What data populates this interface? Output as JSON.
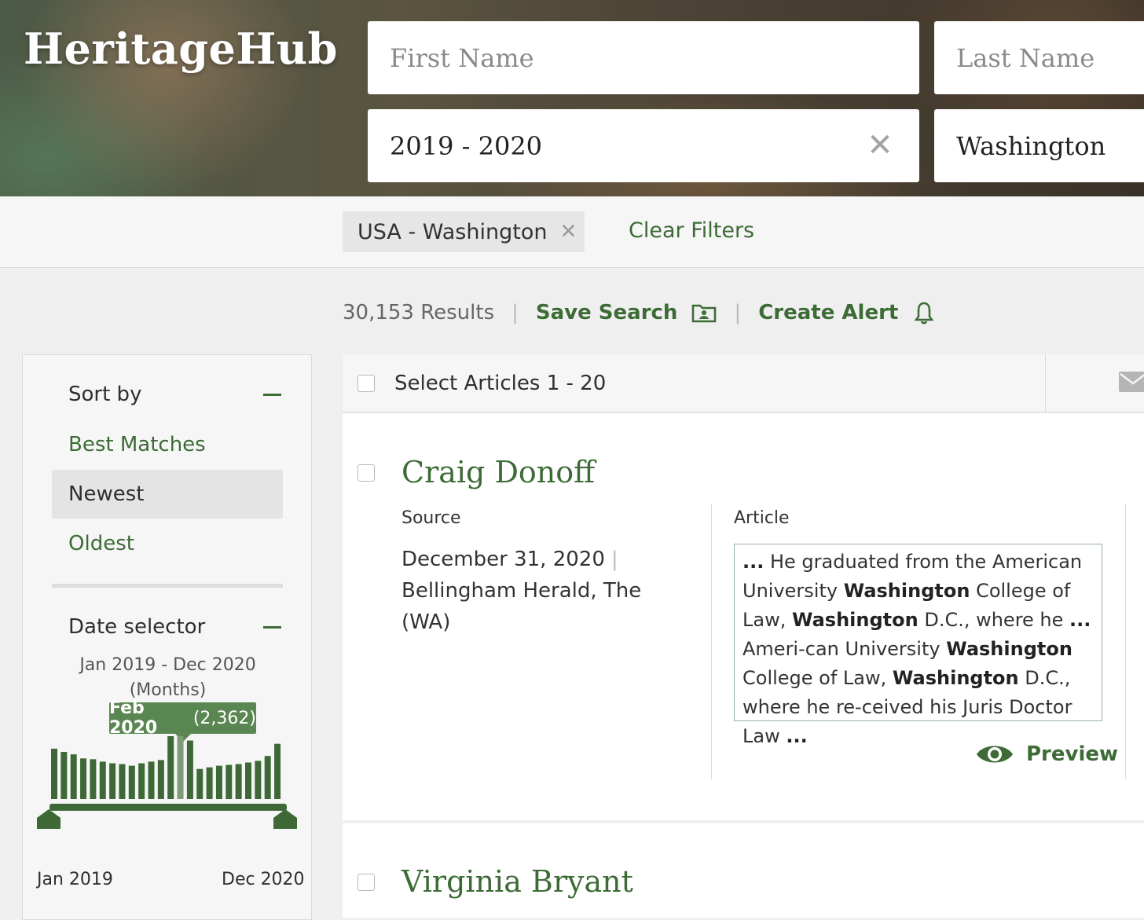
{
  "brand": {
    "name": "HeritageHub"
  },
  "search": {
    "first_name_placeholder": "First Name",
    "last_name_placeholder": "Last Name",
    "date_value": "2019 - 2020",
    "place_value": "Washington"
  },
  "filters": {
    "chip_label": "USA - Washington",
    "clear_label": "Clear Filters"
  },
  "results": {
    "count_text": "30,153 Results",
    "save_search": "Save Search",
    "create_alert": "Create Alert"
  },
  "sidebar": {
    "sort_heading": "Sort by",
    "sort_options": [
      "Best Matches",
      "Newest",
      "Oldest"
    ],
    "sort_selected": "Newest",
    "date_heading": "Date selector",
    "date_range_line1": "Jan 2019 - Dec 2020",
    "date_range_line2": "(Months)",
    "tooltip_month": "Feb 2020",
    "tooltip_count": "(2,362)",
    "range_start": "Jan 2019",
    "range_end": "Dec 2020",
    "histogram_values": [
      62,
      58,
      55,
      50,
      49,
      46,
      44,
      43,
      41,
      44,
      46,
      48,
      89,
      82,
      72,
      37,
      39,
      41,
      42,
      43,
      45,
      47,
      53,
      68
    ],
    "histogram_highlight_index": 13
  },
  "list": {
    "select_label": "Select Articles 1 - 20",
    "records": [
      {
        "name": "Craig Donoff",
        "source_heading": "Source",
        "article_heading": "Article",
        "date": "December 31, 2020",
        "publication": "Bellingham Herald, The (WA)",
        "preview_label": "Preview"
      },
      {
        "name": "Virginia Bryant"
      }
    ]
  },
  "colors": {
    "accent_green": "#3c6b35",
    "tooltip_green": "#5a8651",
    "bar_green": "#3e6937",
    "bar_highlight": "#7e9c77"
  }
}
